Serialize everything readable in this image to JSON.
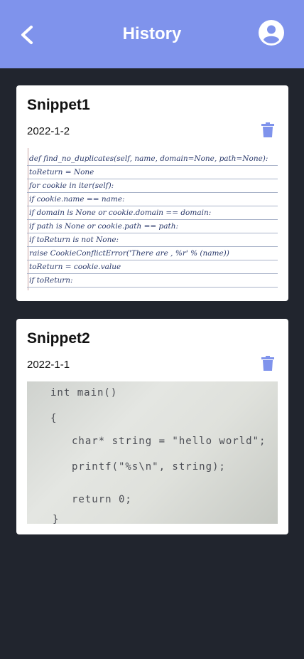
{
  "header": {
    "title": "History",
    "back_icon": "chevron-left-icon",
    "profile_icon": "account-circle-icon",
    "color": "#7f93ec"
  },
  "snippets": [
    {
      "name": "Snippet1",
      "date": "2022-1-2",
      "delete_icon": "trash-icon",
      "lines": [
        "def find_no_duplicates(self, name, domain=None, path=None):",
        "toReturn = None",
        "for cookie in iter(self):",
        "if cookie.name == name:",
        "if domain is None or cookie.domain == domain:",
        "if path is None or cookie.path == path:",
        "if toReturn is not None:",
        "raise CookieConflictError('There are , %r' % (name))",
        "toReturn = cookie.value",
        "if toReturn:"
      ]
    },
    {
      "name": "Snippet2",
      "date": "2022-1-1",
      "delete_icon": "trash-icon",
      "lines": [
        "int main()",
        "{",
        "char* string = \"hello world\";",
        "printf(\"%s\\n\", string);",
        "return 0;",
        "}"
      ]
    }
  ],
  "colors": {
    "background": "#21252e",
    "trash": "#7f93ec"
  }
}
